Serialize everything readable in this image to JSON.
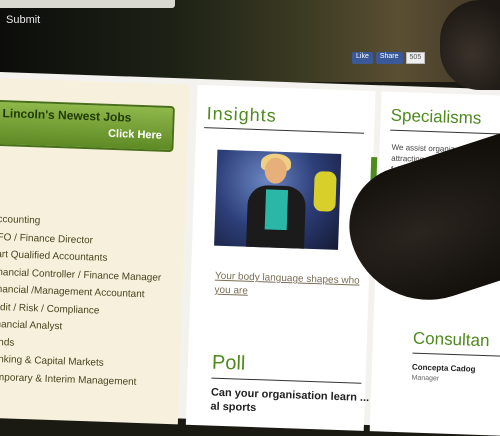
{
  "header": {
    "submit_label": "Submit",
    "social": {
      "like_label": "Like",
      "share_label": "Share",
      "count": "505"
    }
  },
  "left": {
    "jobs_button": {
      "title": "Lincoln's Newest Jobs",
      "cta": "Click Here"
    },
    "specialisms": [
      "Accounting",
      "CFO / Finance Director",
      "Part Qualified Accountants",
      "Financial Controller / Finance Manager",
      "Financial /Management Accountant",
      "Audit / Risk / Compliance",
      "Financial Analyst",
      "Funds",
      "Banking & Capital Markets",
      "Temporary & Interim Management"
    ]
  },
  "insights": {
    "title": "Insights",
    "video_caption": "Your body language shapes who you are"
  },
  "poll": {
    "title": "Poll",
    "question": "Can your organisation learn ... al sports"
  },
  "specialisms_panel": {
    "title": "Specialisms",
    "text": "We assist organizations in attracting the best talent in the following market"
  },
  "consultants": {
    "title": "Consultan",
    "name": "Concepta Cadog",
    "role": "Manager"
  }
}
